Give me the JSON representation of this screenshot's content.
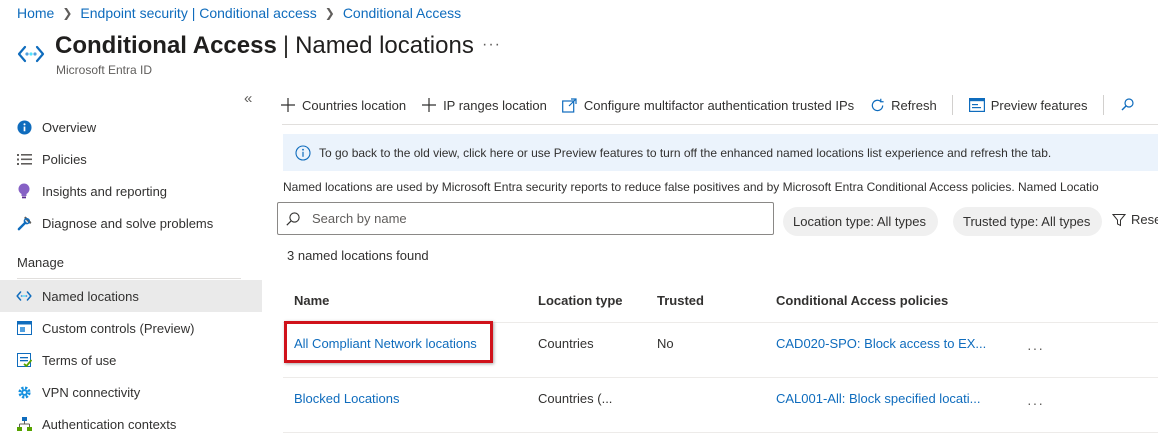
{
  "breadcrumb": [
    "Home",
    "Endpoint security | Conditional access",
    "Conditional Access"
  ],
  "header": {
    "title_main": "Conditional Access",
    "title_sub": "Named locations",
    "subtitle": "Microsoft Entra ID",
    "more": "···"
  },
  "sidebar": {
    "collapse_icon": "«",
    "items": [
      {
        "label": "Overview",
        "icon": "info-icon"
      },
      {
        "label": "Policies",
        "icon": "list-icon"
      },
      {
        "label": "Insights and reporting",
        "icon": "lightbulb-icon"
      },
      {
        "label": "Diagnose and solve problems",
        "icon": "wrench-icon"
      }
    ],
    "manage_label": "Manage",
    "manage_items": [
      {
        "label": "Named locations",
        "icon": "named-locations-icon",
        "active": true
      },
      {
        "label": "Custom controls (Preview)",
        "icon": "custom-controls-icon"
      },
      {
        "label": "Terms of use",
        "icon": "terms-icon"
      },
      {
        "label": "VPN connectivity",
        "icon": "gear-icon"
      },
      {
        "label": "Authentication contexts",
        "icon": "hierarchy-icon"
      }
    ]
  },
  "toolbar": {
    "countries_location": "Countries location",
    "ip_ranges_location": "IP ranges location",
    "configure_mfa": "Configure multifactor authentication trusted IPs",
    "refresh": "Refresh",
    "preview_features": "Preview features"
  },
  "banner": {
    "text": "To go back to the old view, click here or use Preview features to turn off the enhanced named locations list experience and refresh the tab."
  },
  "description": "Named locations are used by Microsoft Entra security reports to reduce false positives and by Microsoft Entra Conditional Access policies. Named Locatio",
  "search": {
    "placeholder": "Search by name",
    "value": ""
  },
  "filters": {
    "location_type": "Location type: All types",
    "trusted_type": "Trusted type: All types",
    "reset": "Rese"
  },
  "results_count": "3 named locations found",
  "table": {
    "columns": [
      "Name",
      "Location type",
      "Trusted",
      "Conditional Access policies"
    ],
    "rows": [
      {
        "name": "All Compliant Network locations",
        "location_type": "Countries",
        "trusted": "No",
        "policies": "CAD020-SPO: Block access to EX...",
        "more": "···"
      },
      {
        "name": "Blocked Locations",
        "location_type": "Countries (...",
        "trusted": "",
        "policies": "CAL001-All: Block specified locati...",
        "more": "···"
      }
    ]
  },
  "colors": {
    "accent": "#0f6cbd",
    "highlight": "#d0121b",
    "banner_bg": "#ebf3fc"
  }
}
